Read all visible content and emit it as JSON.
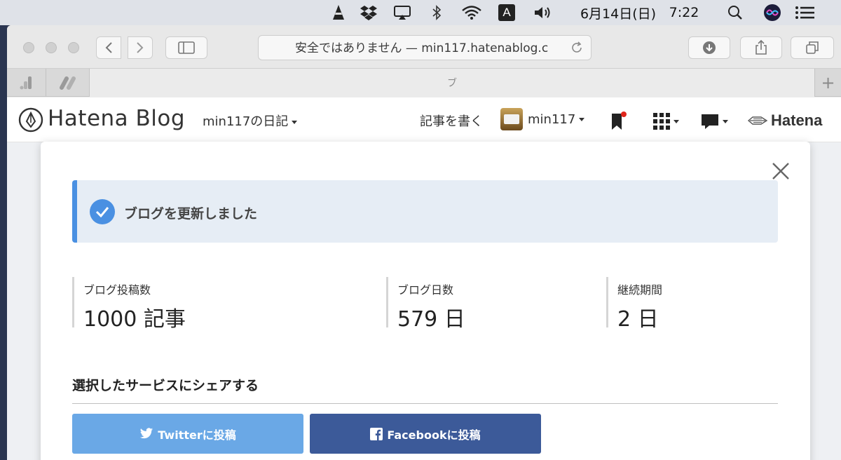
{
  "menubar": {
    "date": "6月14日(日)",
    "time": "7:22",
    "input_mode": "A"
  },
  "browser": {
    "address_text": "安全ではありません — min117.hatenablog.c",
    "tab_title": "ブ",
    "new_tab": "+"
  },
  "hatena": {
    "logo": "Hatena Blog",
    "blog_name": "min117の日記",
    "write": "記事を書く",
    "user": "min117",
    "brand": "Hatena"
  },
  "modal": {
    "notice": "ブログを更新しました",
    "stats": [
      {
        "label": "ブログ投稿数",
        "value": "1000 記事"
      },
      {
        "label": "ブログ日数",
        "value": "579 日"
      },
      {
        "label": "継続期間",
        "value": "2 日"
      }
    ],
    "share_title": "選択したサービスにシェアする",
    "twitter_label": "Twitterに投稿",
    "facebook_label": "Facebookに投稿"
  },
  "colors": {
    "accent": "#4a90e2",
    "twitter": "#6aa8e6",
    "facebook": "#3c5a99",
    "notice_bg": "#e6edf5"
  }
}
